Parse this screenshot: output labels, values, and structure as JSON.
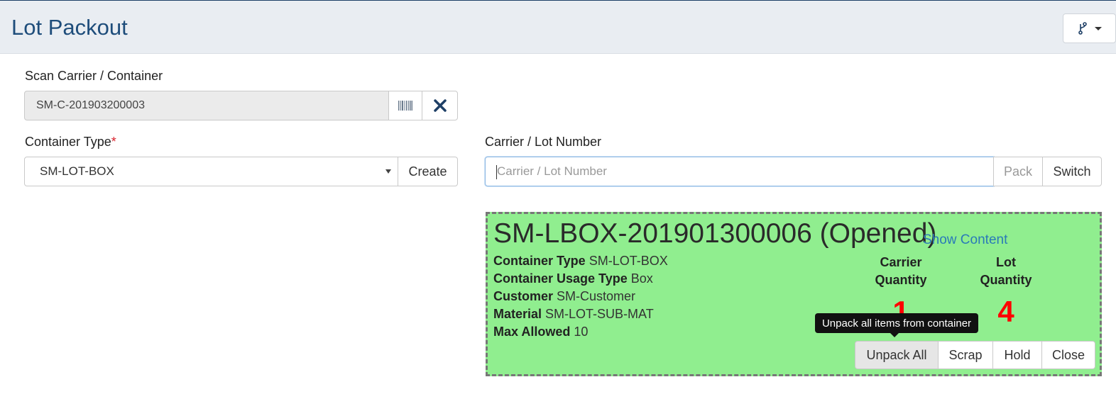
{
  "header": {
    "title": "Lot Packout",
    "menu_icon": "branch-icon"
  },
  "scan": {
    "label": "Scan Carrier / Container",
    "value": "SM-C-201903200003"
  },
  "container_type": {
    "label": "Container Type",
    "required_mark": "*",
    "selected": "SM-LOT-BOX",
    "create_label": "Create"
  },
  "carrier_lot": {
    "label": "Carrier / Lot Number",
    "placeholder": "Carrier / Lot Number",
    "pack_label": "Pack",
    "switch_label": "Switch"
  },
  "container": {
    "title": "SM-LBOX-201901300006 (Opened)",
    "show_content": "Show Content",
    "background_color": "#90ee8f",
    "details": [
      {
        "label": "Container Type",
        "value": "SM-LOT-BOX"
      },
      {
        "label": "Container Usage Type",
        "value": "Box"
      },
      {
        "label": "Customer",
        "value": "SM-Customer"
      },
      {
        "label": "Material",
        "value": "SM-LOT-SUB-MAT"
      },
      {
        "label": "Max Allowed",
        "value": "10"
      }
    ],
    "carrier_quantity_label_1": "Carrier",
    "carrier_quantity_label_2": "Quantity",
    "carrier_quantity": "1",
    "lot_quantity_label_1": "Lot",
    "lot_quantity_label_2": "Quantity",
    "lot_quantity": "4",
    "quantity_color": "#ff0000",
    "tooltip": "Unpack all items from container",
    "actions": [
      "Unpack All",
      "Scrap",
      "Hold",
      "Close"
    ]
  }
}
